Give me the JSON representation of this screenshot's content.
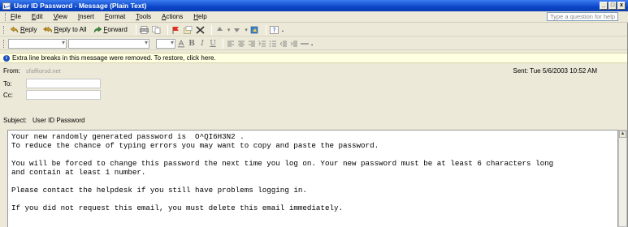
{
  "window": {
    "title": "User ID Password - Message (Plain Text)",
    "minimize": "_",
    "maximize": "□",
    "close": "x"
  },
  "menu": {
    "items": [
      {
        "label": "File"
      },
      {
        "label": "Edit"
      },
      {
        "label": "View"
      },
      {
        "label": "Insert"
      },
      {
        "label": "Format"
      },
      {
        "label": "Tools"
      },
      {
        "label": "Actions"
      },
      {
        "label": "Help"
      }
    ],
    "ask_placeholder": "Type a question for help"
  },
  "toolbar": {
    "reply": "Reply",
    "reply_all": "Reply to All",
    "forward": "Forward"
  },
  "infobar": {
    "text": "Extra line breaks in this message were removed. To restore, click here."
  },
  "header": {
    "from_label": "From:",
    "from_value": "sfaffiorsd.net",
    "to_label": "To:",
    "cc_label": "Cc:",
    "subject_label": "Subject:",
    "subject_value": "User ID Password",
    "sent_label": "Sent:",
    "sent_value": "Tue 5/6/2003 10:52 AM"
  },
  "message": {
    "body": "Your new randomly generated password is  O^QI6H3N2 .\nTo reduce the chance of typing errors you may want to copy and paste the password.\n\nYou will be forced to change this password the next time you log on. Your new password must be at least 6 characters long\nand contain at least 1 number.\n\nPlease contact the helpdesk if you still have problems logging in.\n\nIf you did not request this email, you must delete this email immediately."
  },
  "colors": {
    "titlebar": "#0a46c8",
    "infobar": "#ffffe1",
    "chrome": "#ece9d8"
  }
}
